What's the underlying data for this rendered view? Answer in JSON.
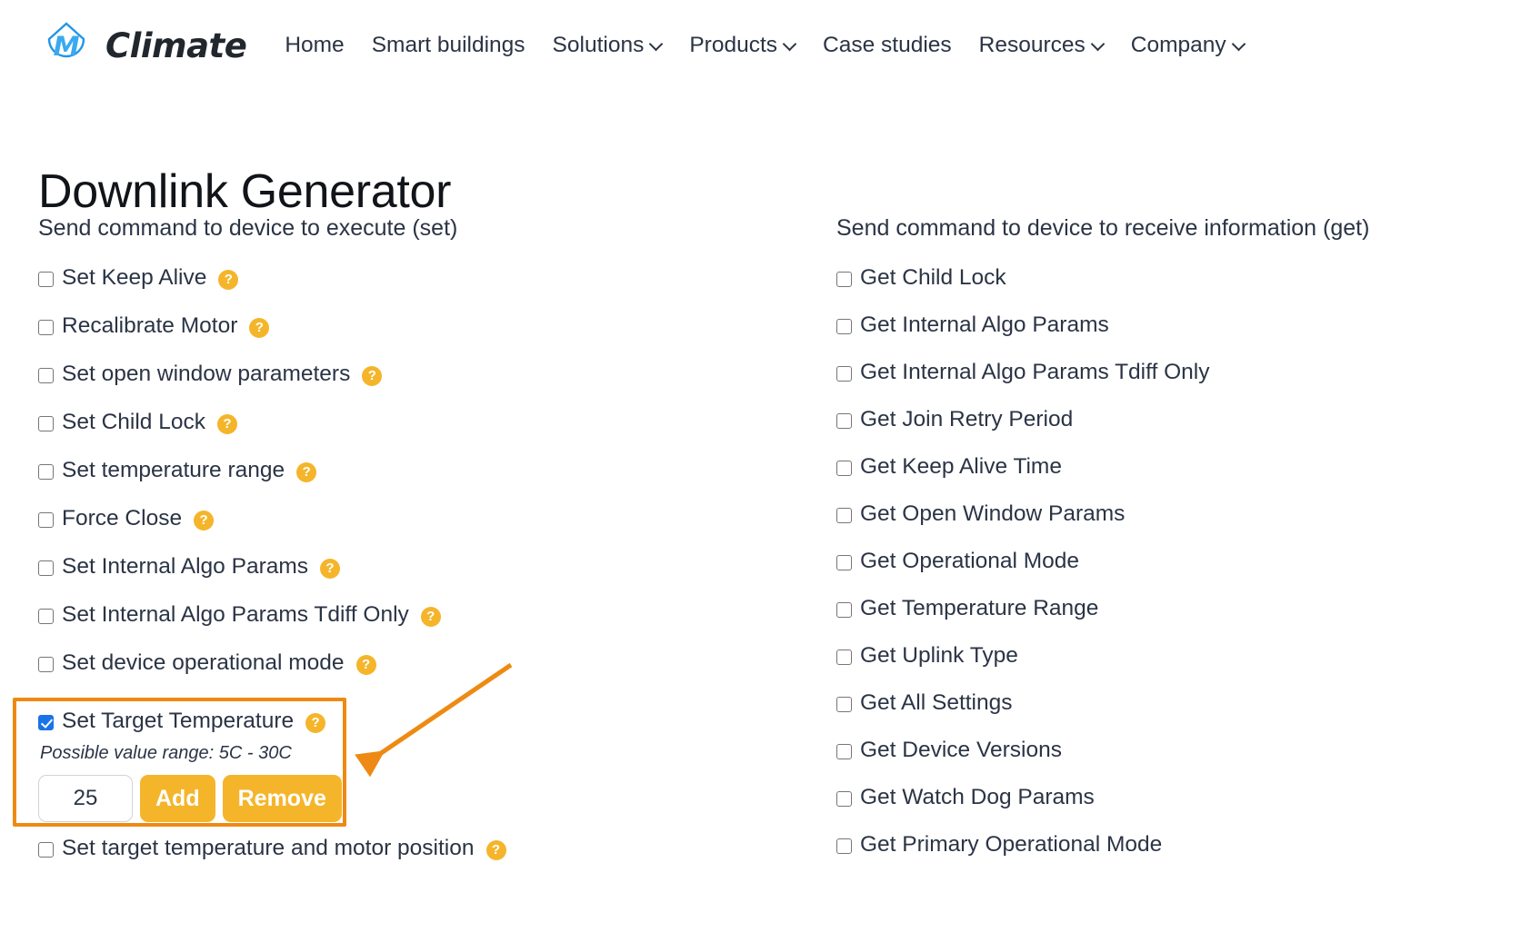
{
  "header": {
    "brand": {
      "mark_letter": "M",
      "name": "Climate",
      "icon": "m-climate-logo"
    },
    "nav": [
      {
        "label": "Home",
        "has_dropdown": false
      },
      {
        "label": "Smart buildings",
        "has_dropdown": false
      },
      {
        "label": "Solutions",
        "has_dropdown": true
      },
      {
        "label": "Products",
        "has_dropdown": true
      },
      {
        "label": "Case studies",
        "has_dropdown": false
      },
      {
        "label": "Resources",
        "has_dropdown": true
      },
      {
        "label": "Company",
        "has_dropdown": true
      }
    ]
  },
  "page": {
    "title": "Downlink Generator"
  },
  "colors": {
    "accent_yellow": "#f5b52b",
    "highlight_orange": "#ee8a13",
    "checkbox_checked_blue": "#1a73e8",
    "brand_blue": "#3aaaf0",
    "text": "#2b3445"
  },
  "set_column": {
    "heading": "Send command to device to execute (set)",
    "items": [
      {
        "label": "Set Keep Alive",
        "checked": false,
        "help": "?"
      },
      {
        "label": "Recalibrate Motor",
        "checked": false,
        "help": "?"
      },
      {
        "label": "Set open window parameters",
        "checked": false,
        "help": "?"
      },
      {
        "label": "Set Child Lock",
        "checked": false,
        "help": "?"
      },
      {
        "label": "Set temperature range",
        "checked": false,
        "help": "?"
      },
      {
        "label": "Force Close",
        "checked": false,
        "help": "?"
      },
      {
        "label": "Set Internal Algo Params",
        "checked": false,
        "help": "?"
      },
      {
        "label": "Set Internal Algo Params Tdiff Only",
        "checked": false,
        "help": "?"
      },
      {
        "label": "Set device operational mode",
        "checked": false,
        "help": "?"
      }
    ],
    "target_temperature": {
      "label": "Set Target Temperature",
      "checked": true,
      "help": "?",
      "range_hint": "Possible value range: 5C - 30C",
      "value": "25",
      "add_label": "Add",
      "remove_label": "Remove"
    },
    "last_item": {
      "label": "Set target temperature and motor position",
      "checked": false,
      "help": "?"
    }
  },
  "get_column": {
    "heading": "Send command to device to receive information (get)",
    "items": [
      {
        "label": "Get Child Lock",
        "checked": false
      },
      {
        "label": "Get Internal Algo Params",
        "checked": false
      },
      {
        "label": "Get Internal Algo Params Tdiff Only",
        "checked": false
      },
      {
        "label": "Get Join Retry Period",
        "checked": false
      },
      {
        "label": "Get Keep Alive Time",
        "checked": false
      },
      {
        "label": "Get Open Window Params",
        "checked": false
      },
      {
        "label": "Get Operational Mode",
        "checked": false
      },
      {
        "label": "Get Temperature Range",
        "checked": false
      },
      {
        "label": "Get Uplink Type",
        "checked": false
      },
      {
        "label": "Get All Settings",
        "checked": false
      },
      {
        "label": "Get Device Versions",
        "checked": false
      },
      {
        "label": "Get Watch Dog Params",
        "checked": false
      },
      {
        "label": "Get Primary Operational Mode",
        "checked": false
      }
    ]
  },
  "annotation": {
    "highlight_box_target": "set-target-temperature-block",
    "arrow": "orange-pointer-arrow"
  }
}
